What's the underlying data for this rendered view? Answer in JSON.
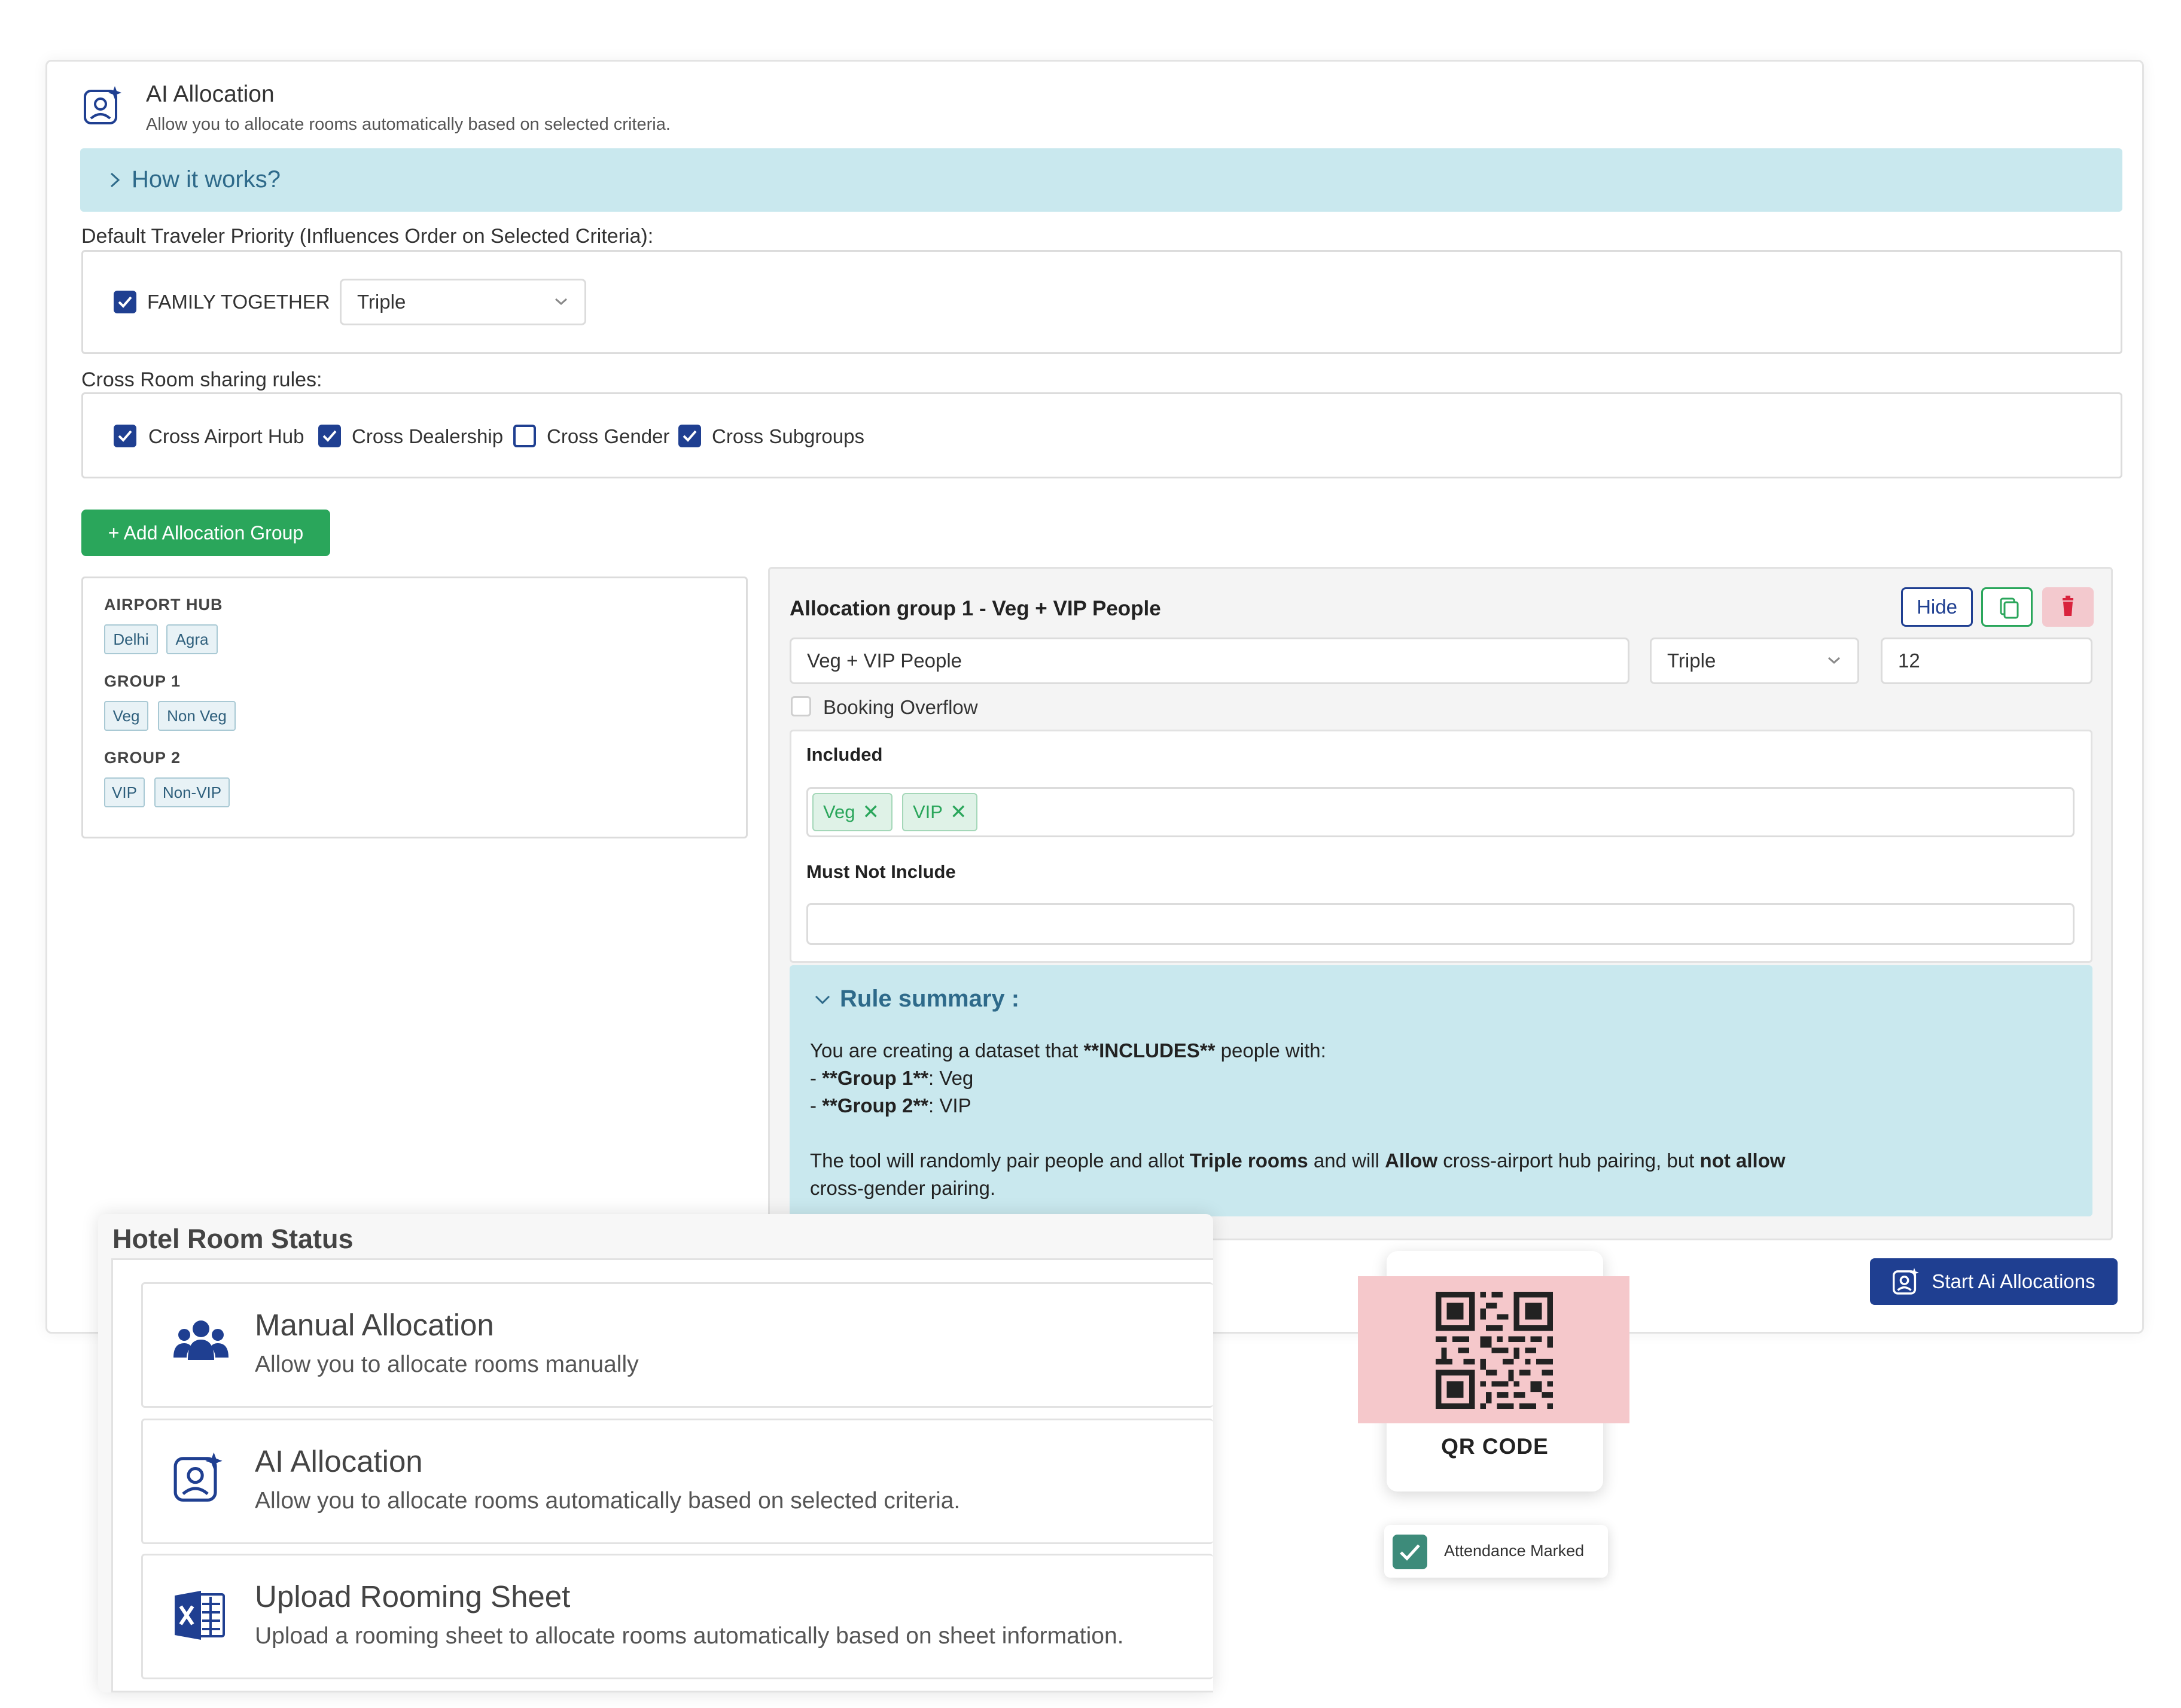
{
  "header": {
    "title": "AI Allocation",
    "subtitle": "Allow you to allocate rooms automatically based on selected criteria."
  },
  "how_it_works": {
    "label": "How it works?"
  },
  "priority": {
    "label": "Default Traveler Priority (Influences Order on Selected Criteria):",
    "family_together": {
      "label": "FAMILY TOGETHER",
      "checked": true
    },
    "room_type": "Triple"
  },
  "cross_room": {
    "label": "Cross Room sharing rules:",
    "rules": [
      {
        "label": "Cross Airport Hub",
        "checked": true
      },
      {
        "label": "Cross Dealership",
        "checked": true
      },
      {
        "label": "Cross Gender",
        "checked": false
      },
      {
        "label": "Cross Subgroups",
        "checked": true
      }
    ]
  },
  "add_group_button": "+ Add Allocation Group",
  "groups_panel": {
    "sections": [
      {
        "title": "AIRPORT HUB",
        "chips": [
          "Delhi",
          "Agra"
        ]
      },
      {
        "title": "GROUP 1",
        "chips": [
          "Veg",
          "Non Veg"
        ]
      },
      {
        "title": "GROUP 2",
        "chips": [
          "VIP",
          "Non-VIP"
        ]
      }
    ]
  },
  "allocation_group": {
    "title": "Allocation group 1 - Veg + VIP People",
    "hide_label": "Hide",
    "name_value": "Veg + VIP People",
    "room_type": "Triple",
    "count": "12",
    "booking_overflow": "Booking Overflow",
    "included_label": "Included",
    "included_tags": [
      "Veg",
      "VIP"
    ],
    "must_not_label": "Must Not Include"
  },
  "rule_summary": {
    "title": "Rule summary :",
    "line1_a": "You are creating a dataset that ",
    "line1_b": "**INCLUDES**",
    "line1_c": " people with:",
    "line2_a": "- ",
    "line2_b": "**Group 1**",
    "line2_c": ": Veg",
    "line3_a": "- ",
    "line3_b": "**Group 2**",
    "line3_c": ": VIP",
    "line4_a": "The tool will randomly pair people and allot ",
    "line4_b": "Triple rooms",
    "line4_c": " and will ",
    "line4_d": "Allow",
    "line4_e": " cross-airport hub pairing, but ",
    "line4_f": "not allow",
    "line5": "cross-gender pairing."
  },
  "start_button": "Start Ai Allocations",
  "hotel_room_status": {
    "title": "Hotel Room Status",
    "options": [
      {
        "title": "Manual Allocation",
        "subtitle": "Allow you to allocate rooms manually",
        "icon": "users-icon"
      },
      {
        "title": "AI Allocation",
        "subtitle": "Allow you to allocate rooms automatically based on selected criteria.",
        "icon": "ai-user-icon"
      },
      {
        "title": "Upload Rooming Sheet",
        "subtitle": "Upload a rooming sheet to allocate rooms automatically based on sheet information.",
        "icon": "excel-icon"
      }
    ]
  },
  "qr": {
    "label": "QR CODE"
  },
  "attendance": {
    "label": "Attendance Marked"
  },
  "colors": {
    "primary": "#1f3f91",
    "success": "#2aa65b",
    "info_bg": "#c9e8ee",
    "danger_bg": "#f3c9ce",
    "qr_bg": "#f5c8cb",
    "attendance": "#3d8b7a"
  }
}
